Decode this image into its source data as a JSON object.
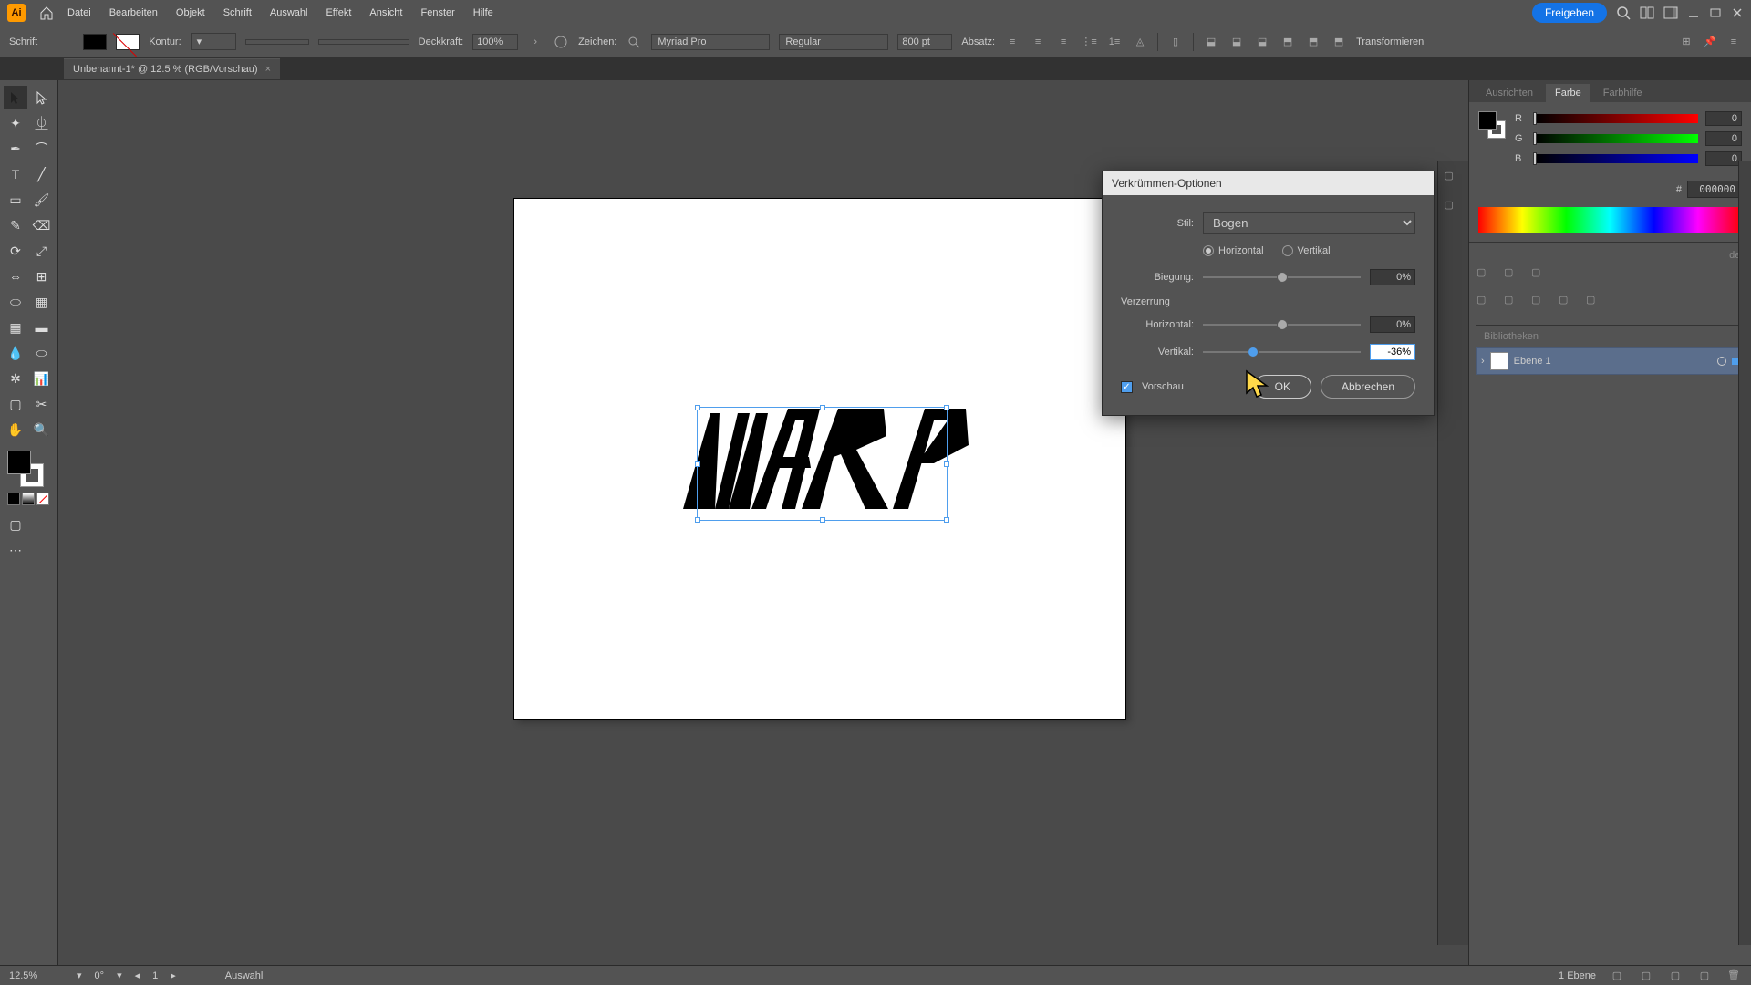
{
  "menubar": {
    "items": [
      "Datei",
      "Bearbeiten",
      "Objekt",
      "Schrift",
      "Auswahl",
      "Effekt",
      "Ansicht",
      "Fenster",
      "Hilfe"
    ],
    "share": "Freigeben"
  },
  "controlbar": {
    "mode": "Schrift",
    "kontur_label": "Kontur:",
    "deckkraft_label": "Deckkraft:",
    "deckkraft_value": "100%",
    "zeichen_label": "Zeichen:",
    "font": "Myriad Pro",
    "font_style": "Regular",
    "font_size": "800 pt",
    "absatz_label": "Absatz:",
    "transform": "Transformieren"
  },
  "document": {
    "tab": "Unbenannt-1* @ 12.5 % (RGB/Vorschau)"
  },
  "artboard": {
    "text": "WARP"
  },
  "dialog": {
    "title": "Verkrümmen-Optionen",
    "stil_label": "Stil:",
    "stil_value": "Bogen",
    "horizontal": "Horizontal",
    "vertikal": "Vertikal",
    "biegung_label": "Biegung:",
    "biegung_value": "0%",
    "verzerrung": "Verzerrung",
    "h_label": "Horizontal:",
    "h_value": "0%",
    "v_label": "Vertikal:",
    "v_value": "-36%",
    "vorschau": "Vorschau",
    "ok": "OK",
    "abbrechen": "Abbrechen"
  },
  "color_panel": {
    "tabs": [
      "Ausrichten",
      "Farbe",
      "Farbhilfe"
    ],
    "r": "0",
    "g": "0",
    "b": "0",
    "hex_label": "#",
    "hex": "000000"
  },
  "layers": {
    "header_obscured": "der",
    "layer_name": "Ebene 1",
    "bibliotheken": "Bibliotheken"
  },
  "statusbar": {
    "zoom": "12.5%",
    "rotation": "0°",
    "artboard_num": "1",
    "tool": "Auswahl",
    "layer_count": "1 Ebene"
  }
}
